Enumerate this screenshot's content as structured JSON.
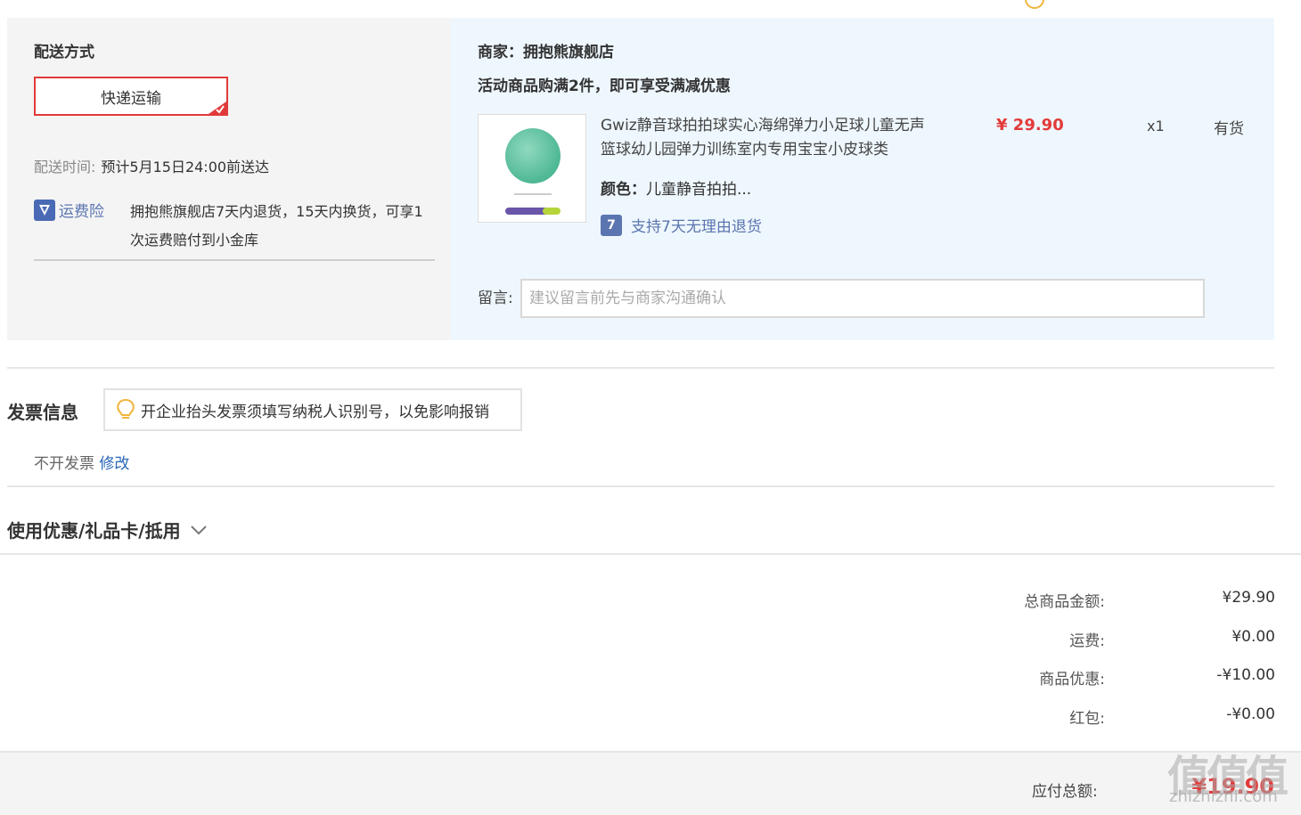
{
  "delivery": {
    "title": "配送方式",
    "method_label": "快递运输",
    "time_label": "配送时间:",
    "time_value": "预计5月15日24:00前送达",
    "insurance_label": "运费险",
    "insurance_text": "拥抱熊旗舰店7天内退货，15天内换货，可享1次运费赔付到小金库"
  },
  "store": {
    "name_line": "商家：拥抱熊旗舰店",
    "promo": "活动商品购满2件，即可享受满减优惠",
    "product": {
      "title": "Gwiz静音球拍拍球实心海绵弹力小足球儿童无声篮球幼儿园弹力训练室内专用宝宝小皮球类",
      "price": "¥ 29.90",
      "qty": "x1",
      "stock": "有货",
      "color_label": "颜色：",
      "color_value": "儿童静音拍拍...",
      "return_policy": "支持7天无理由退货",
      "return_icon_text": "7"
    },
    "message": {
      "label": "留言:",
      "placeholder": "建议留言前先与商家沟通确认"
    }
  },
  "invoice": {
    "title": "发票信息",
    "tip": "开企业抬头发票须填写纳税人识别号，以免影响报销",
    "status": "不开发票",
    "edit_label": "修改"
  },
  "coupon": {
    "title": "使用优惠/礼品卡/抵用"
  },
  "summary": {
    "rows": [
      {
        "label": "总商品金额:",
        "value": "¥29.90"
      },
      {
        "label": "运费:",
        "value": "¥0.00"
      },
      {
        "label": "商品优惠:",
        "value": "-¥10.00"
      },
      {
        "label": "红包:",
        "value": "-¥0.00"
      }
    ],
    "total_label": "应付总额:",
    "total_value": "¥19.90"
  },
  "watermark": {
    "logo": "值值值",
    "url": "zhizhizhi.com"
  },
  "colors": {
    "accent_red": "#e23a3a",
    "link_blue": "#2a66b8",
    "store_bg": "#eef7fd",
    "delivery_bg": "#f4f4f4"
  }
}
